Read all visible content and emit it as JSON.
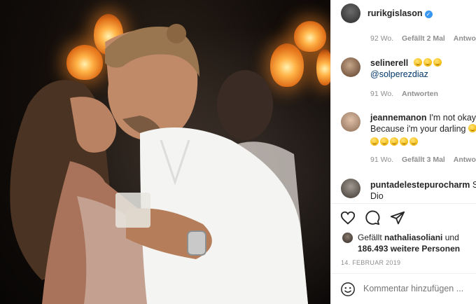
{
  "post": {
    "author": "rurikgislason",
    "date": "14. FEBRUAR 2019"
  },
  "comments": [
    {
      "time": "92 Wo.",
      "likes": "Gefällt 2 Mal",
      "reply": "Antworten"
    },
    {
      "user": "selinerell",
      "text": "@solperezdiaz",
      "time": "91 Wo.",
      "reply": "Antworten"
    },
    {
      "user": "jeannemanon",
      "text1": "I'm not okay!",
      "text2": "Because i'm your darling",
      "time": "91 Wo.",
      "likes": "Gefällt 3 Mal",
      "reply": "Antworten"
    },
    {
      "user": "puntadelestepurocharm",
      "text1": "Sa",
      "text2": "Dio"
    }
  ],
  "likes": {
    "prefix": "Gefällt",
    "user": "nathaliasoliani",
    "joiner": "und",
    "count": "186.493 weitere Personen"
  },
  "comment_box": {
    "placeholder": "Kommentar hinzufügen ..."
  },
  "icons": {
    "like": "heart-icon",
    "comment": "comment-icon",
    "share": "share-icon",
    "emoji": "emoji-icon",
    "verified": "verified-badge-icon"
  },
  "colors": {
    "accent": "#3897f0",
    "mention": "#00376b",
    "meta": "#8e8e8e"
  }
}
